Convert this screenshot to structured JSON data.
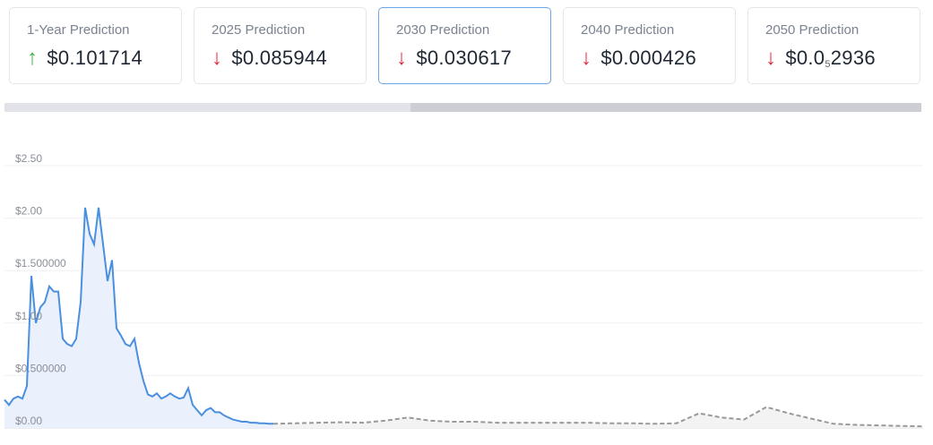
{
  "cards": [
    {
      "label": "1-Year Prediction",
      "direction": "up",
      "value": "$0.101714"
    },
    {
      "label": "2025 Prediction",
      "direction": "down",
      "value": "$0.085944"
    },
    {
      "label": "2030 Prediction",
      "direction": "down",
      "value": "$0.030617",
      "active": true
    },
    {
      "label": "2040 Prediction",
      "direction": "down",
      "value": "$0.000426"
    },
    {
      "label": "2050 Prediction",
      "direction": "down",
      "value_prefix": "$0.0",
      "value_sub": "5",
      "value_suffix": "2936"
    }
  ],
  "icons": {
    "up": "↑",
    "down": "↓"
  },
  "chart_data": {
    "type": "line",
    "ylim": [
      0,
      2.5
    ],
    "ytick_labels": [
      "$0.00",
      "$0.500000",
      "$1.00",
      "$1.500000",
      "$2.00",
      "$2.50"
    ],
    "yticks": [
      0,
      0.5,
      1,
      1.5,
      2,
      2.5
    ],
    "grid": true,
    "series": [
      {
        "name": "historical",
        "style": "solid-area",
        "color": "#4a8fe0",
        "values": [
          0.27,
          0.22,
          0.28,
          0.3,
          0.28,
          0.4,
          1.45,
          1.0,
          1.15,
          1.2,
          1.35,
          1.3,
          1.3,
          0.85,
          0.8,
          0.78,
          0.85,
          1.2,
          2.1,
          1.85,
          1.75,
          2.1,
          1.75,
          1.4,
          1.6,
          0.95,
          0.88,
          0.8,
          0.78,
          0.85,
          0.62,
          0.45,
          0.32,
          0.3,
          0.33,
          0.28,
          0.3,
          0.33,
          0.3,
          0.28,
          0.29,
          0.38,
          0.22,
          0.17,
          0.12,
          0.17,
          0.19,
          0.15,
          0.15,
          0.12,
          0.1,
          0.08,
          0.07,
          0.06,
          0.06,
          0.05,
          0.05,
          0.045,
          0.045,
          0.04,
          0.04
        ]
      },
      {
        "name": "forecast",
        "style": "dashed-area",
        "color": "#999999",
        "values": [
          0.04,
          0.045,
          0.05,
          0.055,
          0.05,
          0.07,
          0.1,
          0.07,
          0.06,
          0.06,
          0.05,
          0.05,
          0.05,
          0.05,
          0.05,
          0.045,
          0.045,
          0.04,
          0.045,
          0.14,
          0.1,
          0.08,
          0.2,
          0.14,
          0.09,
          0.04,
          0.03,
          0.025,
          0.02,
          0.015
        ]
      }
    ]
  }
}
